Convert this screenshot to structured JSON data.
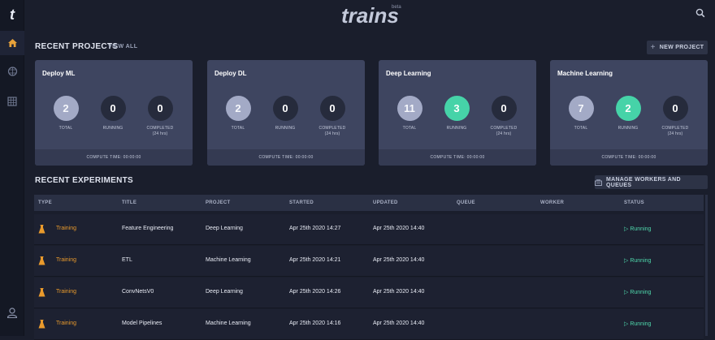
{
  "app": {
    "brand": "trains",
    "brand_badge": "beta"
  },
  "projects_section": {
    "title": "RECENT PROJECTS",
    "view_all": "VIEW ALL",
    "new_project": "NEW PROJECT"
  },
  "projects": [
    {
      "name": "Deploy ML",
      "total": "2",
      "running": "0",
      "completed": "0",
      "compute_time": "COMPUTE TIME: 00:00:00"
    },
    {
      "name": "Deploy DL",
      "total": "2",
      "running": "0",
      "completed": "0",
      "compute_time": "COMPUTE TIME: 00:00:00"
    },
    {
      "name": "Deep Learning",
      "total": "11",
      "running": "3",
      "completed": "0",
      "compute_time": "COMPUTE TIME: 00:00:00"
    },
    {
      "name": "Machine Learning",
      "total": "7",
      "running": "2",
      "completed": "0",
      "compute_time": "COMPUTE TIME: 00:00:00"
    }
  ],
  "stat_labels": {
    "total": "TOTAL",
    "running": "RUNNING",
    "completed": "COMPLETED",
    "completed_sub": "(24 hrs)"
  },
  "experiments_section": {
    "title": "RECENT EXPERIMENTS",
    "manage": "MANAGE WORKERS AND QUEUES"
  },
  "columns": [
    "TYPE",
    "TITLE",
    "PROJECT",
    "STARTED",
    "UPDATED",
    "QUEUE",
    "WORKER",
    "STATUS"
  ],
  "experiments": [
    {
      "type": "Training",
      "title": "Feature Engineering",
      "project": "Deep Learning",
      "started": "Apr 25th 2020 14:27",
      "updated": "Apr 25th 2020 14:40",
      "queue": "",
      "worker": "",
      "status": "Running"
    },
    {
      "type": "Training",
      "title": "ETL",
      "project": "Machine Learning",
      "started": "Apr 25th 2020 14:21",
      "updated": "Apr 25th 2020 14:40",
      "queue": "",
      "worker": "",
      "status": "Running"
    },
    {
      "type": "Training",
      "title": "ConvNetsV0",
      "project": "Deep Learning",
      "started": "Apr 25th 2020 14:26",
      "updated": "Apr 25th 2020 14:40",
      "queue": "",
      "worker": "",
      "status": "Running"
    },
    {
      "type": "Training",
      "title": "Model Pipelines",
      "project": "Machine Learning",
      "started": "Apr 25th 2020 14:16",
      "updated": "Apr 25th 2020 14:40",
      "queue": "",
      "worker": "",
      "status": "Running"
    }
  ],
  "colors": {
    "accent_green": "#46d3a8",
    "training_orange": "#e99a2c",
    "home_icon_orange": "#e8a23a"
  },
  "icons": {
    "sidebar": [
      "home-icon",
      "brain-icon",
      "workers-icon",
      "user-icon"
    ],
    "search": "search-icon",
    "status": "play-icon",
    "type": "flask-icon"
  }
}
